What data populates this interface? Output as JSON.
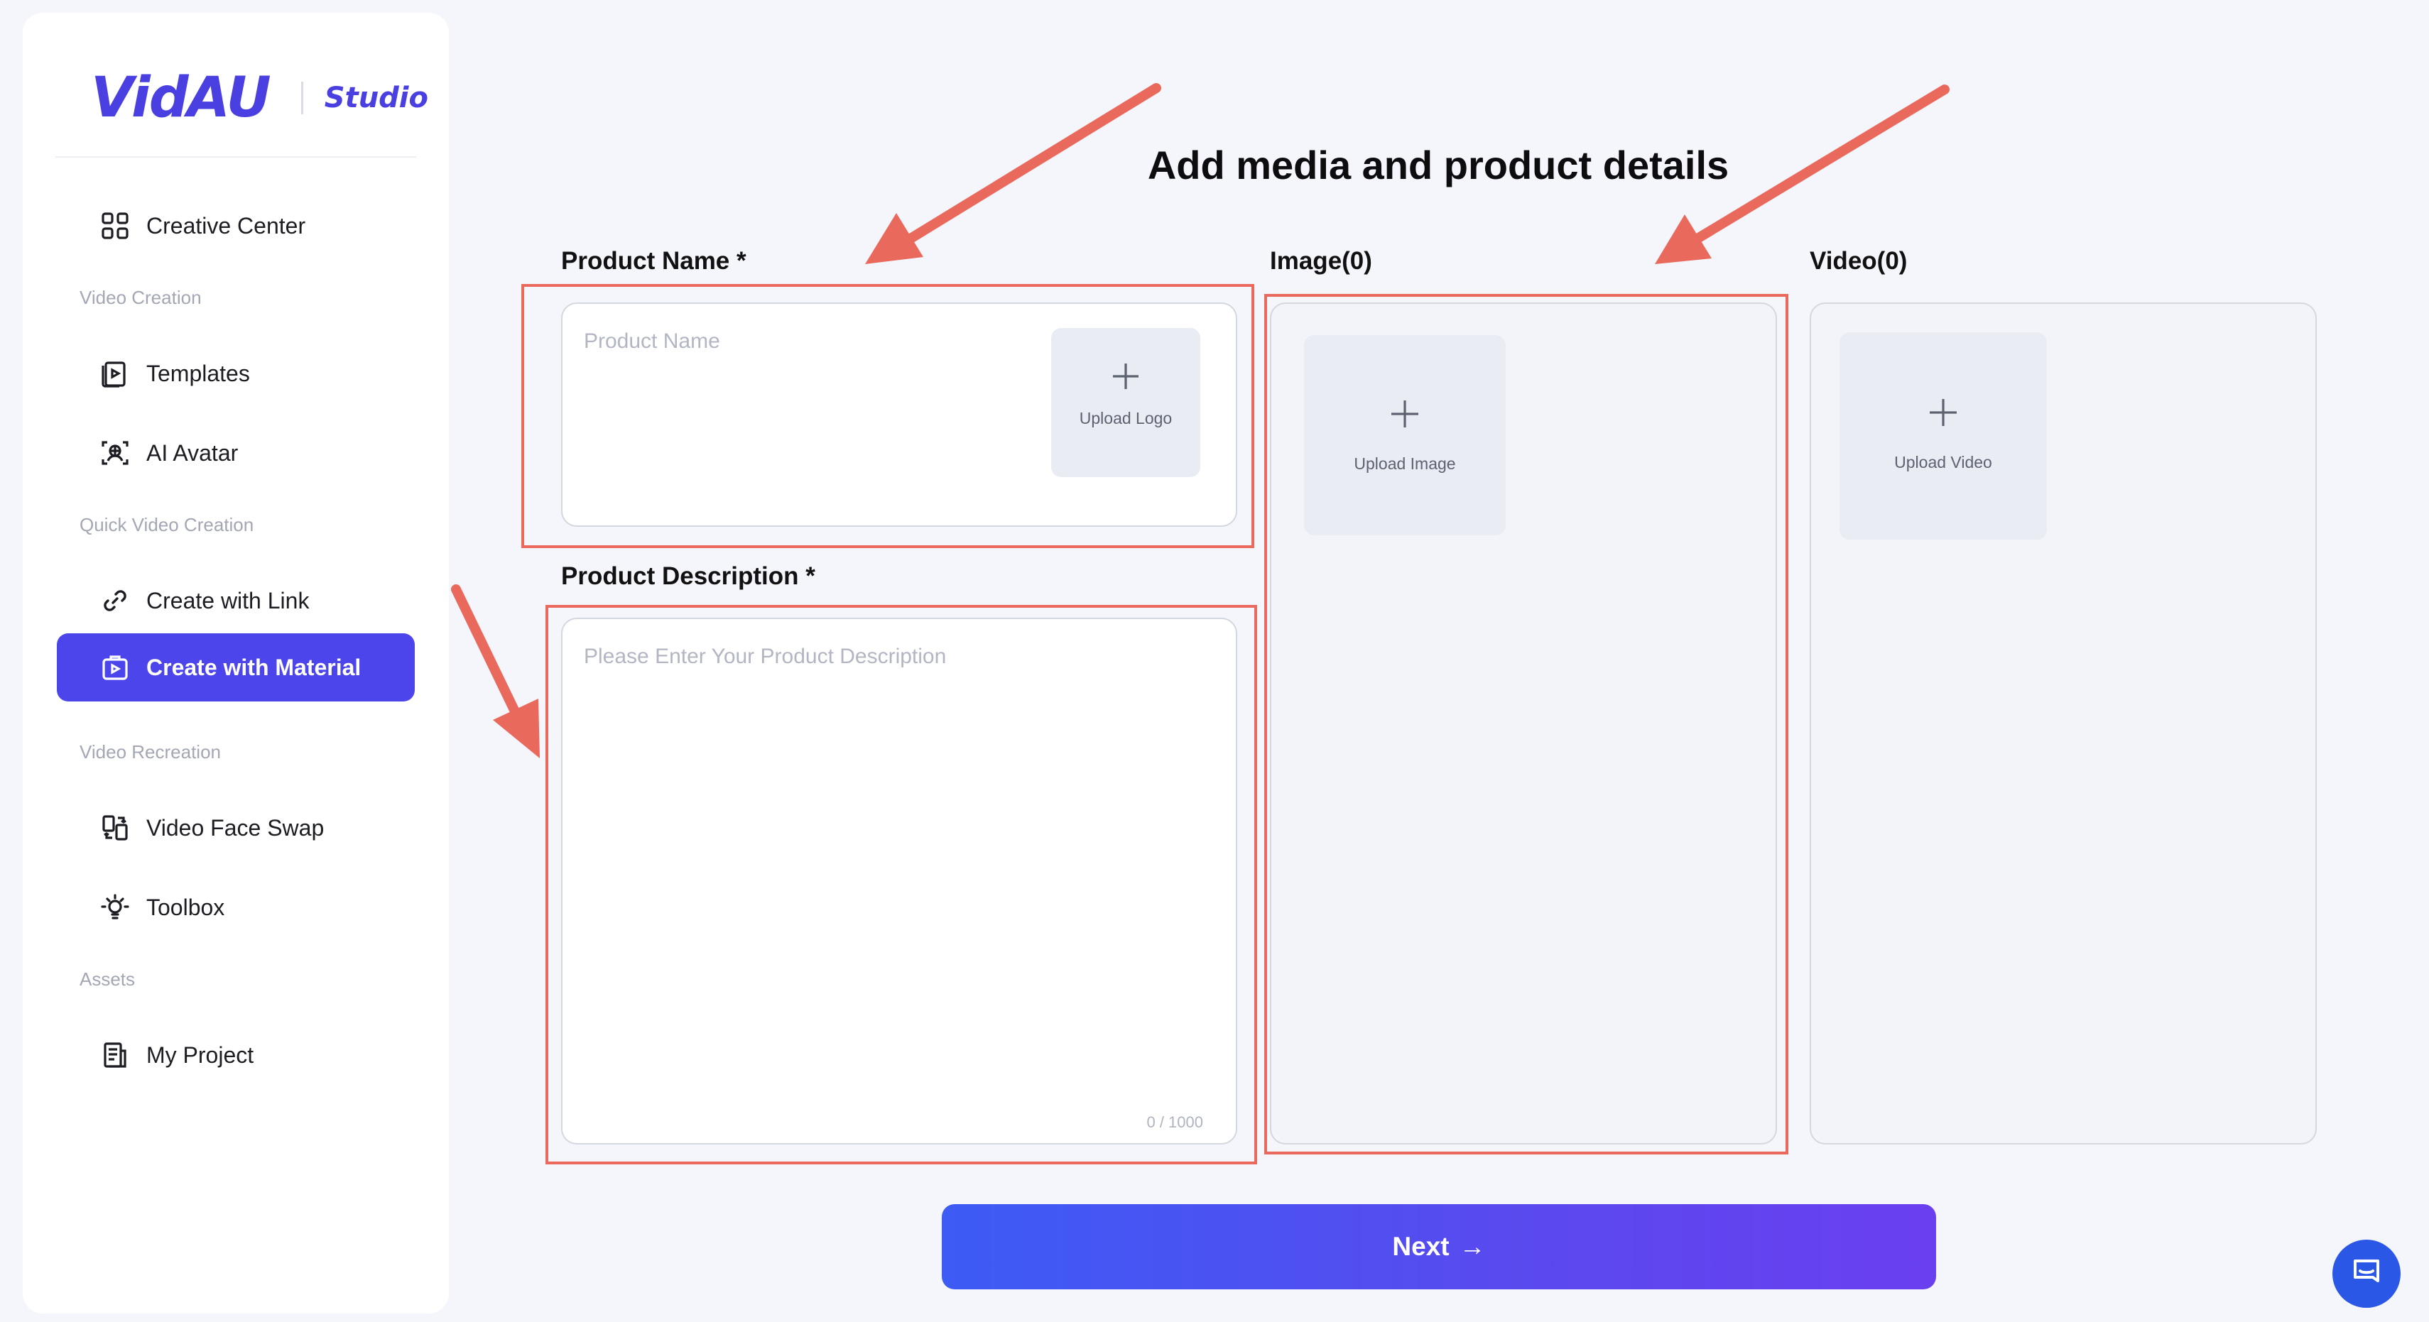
{
  "logo": {
    "brand": "VidAU",
    "product": "Studio"
  },
  "sidebar": {
    "creative_center": "Creative Center",
    "sections": {
      "video_creation": "Video Creation",
      "quick_video_creation": "Quick Video Creation",
      "video_recreation": "Video Recreation",
      "assets": "Assets"
    },
    "items": {
      "templates": "Templates",
      "ai_avatar": "AI Avatar",
      "create_with_link": "Create with Link",
      "create_with_material": "Create with Material",
      "video_face_swap": "Video Face Swap",
      "toolbox": "Toolbox",
      "my_project": "My Project"
    }
  },
  "main": {
    "title": "Add media and product details",
    "product_name": {
      "label": "Product Name *",
      "placeholder": "Product Name",
      "upload_logo": "Upload Logo"
    },
    "product_description": {
      "label": "Product Description *",
      "placeholder": "Please Enter Your Product Description",
      "counter": "0 / 1000"
    },
    "image": {
      "label": "Image(0)",
      "upload": "Upload Image"
    },
    "video": {
      "label": "Video(0)",
      "upload": "Upload Video"
    },
    "next_button": "Next",
    "next_arrow": "→"
  },
  "colors": {
    "accent": "#4c45ec",
    "annotation": "#e96a5c",
    "fab": "#2b57e6"
  },
  "icons": [
    "grid-icon",
    "template-icon",
    "avatar-icon",
    "link-icon",
    "material-icon",
    "face-swap-icon",
    "bulb-icon",
    "project-icon",
    "plus-icon",
    "arrow-right-icon",
    "chat-icon"
  ]
}
